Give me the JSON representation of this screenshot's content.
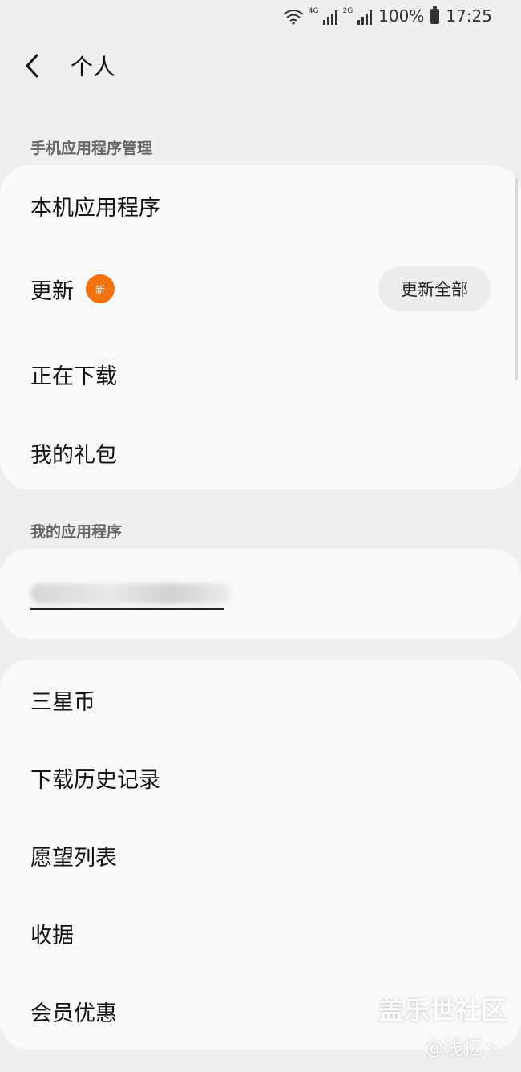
{
  "status_bar": {
    "battery": "100%",
    "time": "17:25",
    "net_1": "4G",
    "net_2": "2G"
  },
  "header": {
    "title": "个人"
  },
  "section_app_management": {
    "label": "手机应用程序管理",
    "items": {
      "local_apps": "本机应用程序",
      "updates": "更新",
      "updates_badge": "新",
      "update_all": "更新全部",
      "downloading": "正在下载",
      "gifts": "我的礼包"
    }
  },
  "section_my_apps": {
    "label": "我的应用程序"
  },
  "section_more": {
    "items": [
      "三星币",
      "下载历史记录",
      "愿望列表",
      "收据",
      "会员优惠"
    ]
  },
  "watermark": {
    "title": "盖乐世社区",
    "author": "@浅忆丶"
  }
}
